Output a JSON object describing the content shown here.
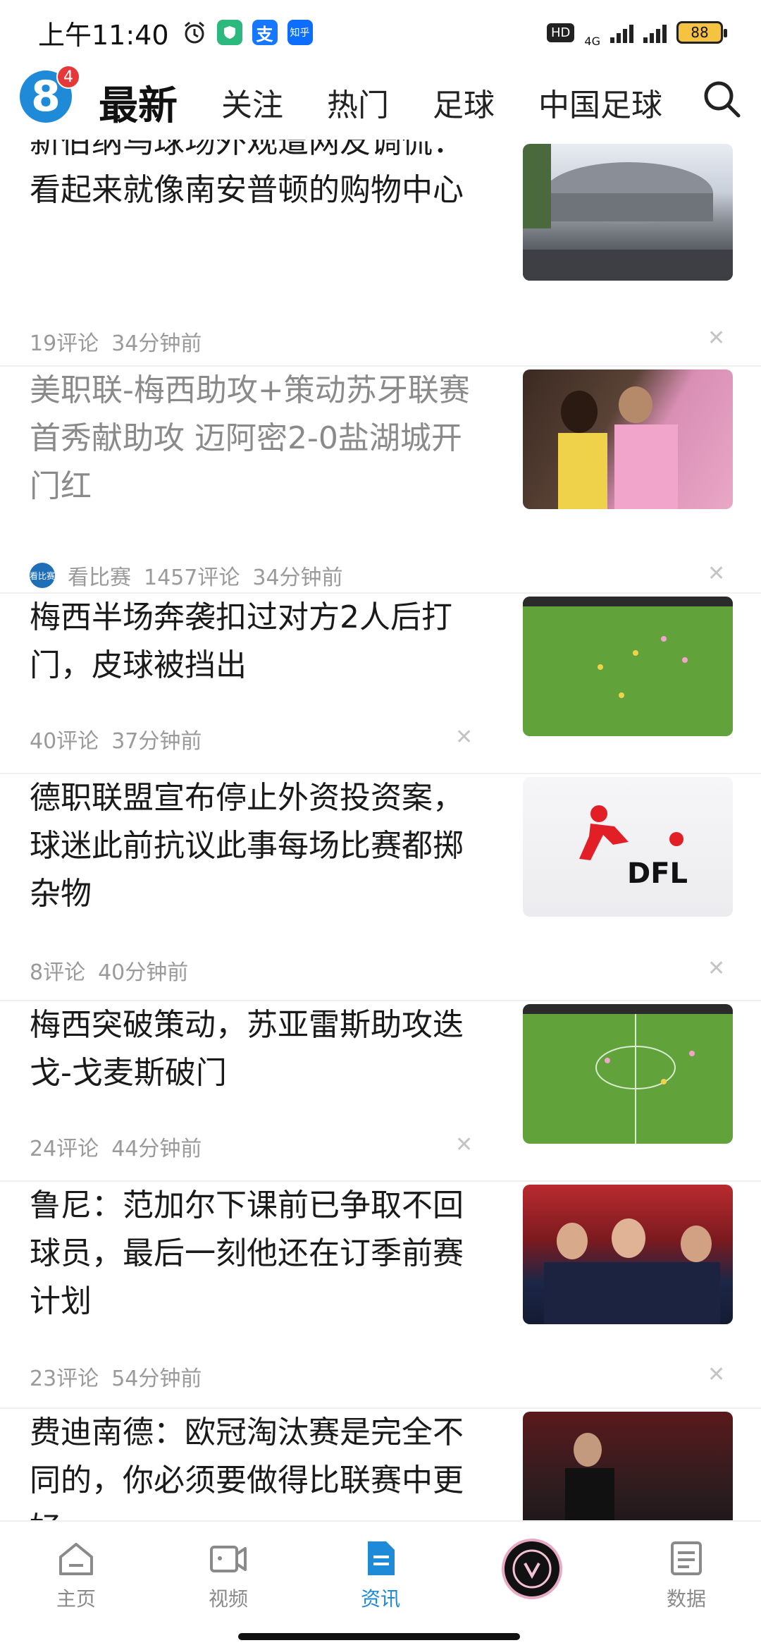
{
  "status_bar": {
    "time": "上午11:40",
    "app_icons": [
      "alarm-icon",
      "shield-app-icon",
      "alipay-icon",
      "zhihu-icon"
    ],
    "zhihu_label": "知乎",
    "alipay_label": "支",
    "hd_label": "HD",
    "network_label": "4G",
    "battery_level": "88"
  },
  "header": {
    "logo_text": "8",
    "badge_count": "4",
    "tabs": [
      {
        "label": "最新",
        "active": true
      },
      {
        "label": "关注",
        "active": false
      },
      {
        "label": "热门",
        "active": false
      },
      {
        "label": "足球",
        "active": false
      },
      {
        "label": "中国足球",
        "active": false
      }
    ]
  },
  "articles": [
    {
      "title": "新伯纳乌球场外观遭网友调侃：看起来就像南安普顿的购物中心",
      "comments": "19评论",
      "time": "34分钟前",
      "source": "",
      "read": false
    },
    {
      "title": "美职联-梅西助攻+策动苏牙联赛首秀献助攻 迈阿密2-0盐湖城开门红",
      "comments": "1457评论",
      "time": "34分钟前",
      "source": "看比赛",
      "source_badge": "看比赛",
      "read": true
    },
    {
      "title": "梅西半场奔袭扣过对方2人后打门，皮球被挡出",
      "comments": "40评论",
      "time": "37分钟前",
      "source": "",
      "read": false
    },
    {
      "title": "德职联盟宣布停止外资投资案，球迷此前抗议此事每场比赛都掷杂物",
      "comments": "8评论",
      "time": "40分钟前",
      "source": "",
      "read": false,
      "thumb_text": "DFL"
    },
    {
      "title": "梅西突破策动，苏亚雷斯助攻迭戈-戈麦斯破门",
      "comments": "24评论",
      "time": "44分钟前",
      "source": "",
      "read": false
    },
    {
      "title": "鲁尼：范加尔下课前已争取不回球员，最后一刻他还在订季前赛计划",
      "comments": "23评论",
      "time": "54分钟前",
      "source": "",
      "read": false
    },
    {
      "title": "费迪南德：欧冠淘汰赛是完全不同的，你必须要做得比联赛中更好",
      "comments": "",
      "time": "",
      "source": "",
      "read": false
    }
  ],
  "bottom_nav": [
    {
      "label": "主页",
      "icon": "home-icon",
      "active": false
    },
    {
      "label": "视频",
      "icon": "video-icon",
      "active": false
    },
    {
      "label": "资讯",
      "icon": "news-icon",
      "active": true
    },
    {
      "label": "",
      "icon": "inter-miami-badge-icon",
      "active": false
    },
    {
      "label": "数据",
      "icon": "data-icon",
      "active": false
    }
  ],
  "colors": {
    "accent": "#1e8ad8",
    "badge_red": "#e5383b",
    "meta_gray": "#9a9a9a",
    "read_title": "#8a8a8a"
  }
}
